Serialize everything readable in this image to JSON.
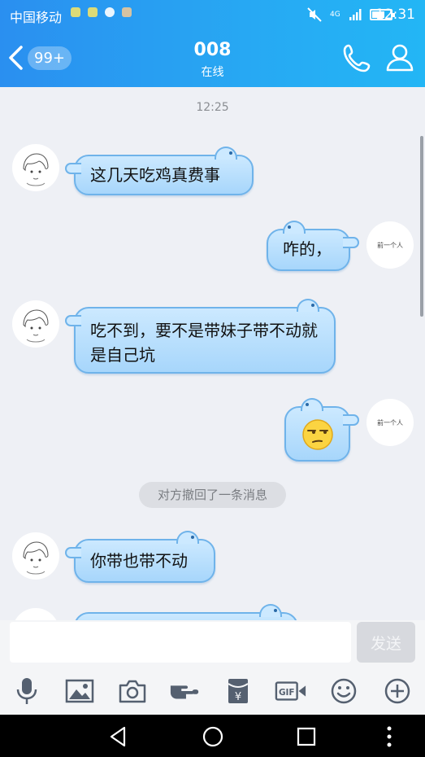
{
  "status_bar": {
    "carrier": "中国移动",
    "network": "4G",
    "time": "12:31",
    "battery_level": 0.7
  },
  "header": {
    "back_badge": "99+",
    "contact_name": "008",
    "contact_status": "在线"
  },
  "chat": {
    "timestamp": "12:25",
    "messages": [
      {
        "side": "left",
        "text": "这几天吃鸡真费事"
      },
      {
        "side": "right",
        "text": "咋的，"
      },
      {
        "side": "left",
        "text": "吃不到，要不是带妹子带不动就是自己坑"
      },
      {
        "side": "right",
        "type": "emoji",
        "emoji": "unamused-face"
      },
      {
        "side": "left",
        "text": "你带也带不动"
      }
    ],
    "recall_notice": "对方撤回了一条消息",
    "self_avatar_text": "前一个人"
  },
  "input": {
    "placeholder": "",
    "send_label": "发送"
  },
  "toolbar": {
    "items": [
      "microphone-icon",
      "image-icon",
      "camera-icon",
      "hand-icon",
      "red-packet-icon",
      "gif-icon",
      "emoji-icon",
      "plus-icon"
    ],
    "red_packet_symbol": "¥",
    "gif_label": "GIF"
  },
  "colors": {
    "header_start": "#2a8ff0",
    "header_end": "#23b6f5",
    "bubble": "#a7d6fb",
    "bubble_border": "#6fb3ea"
  }
}
